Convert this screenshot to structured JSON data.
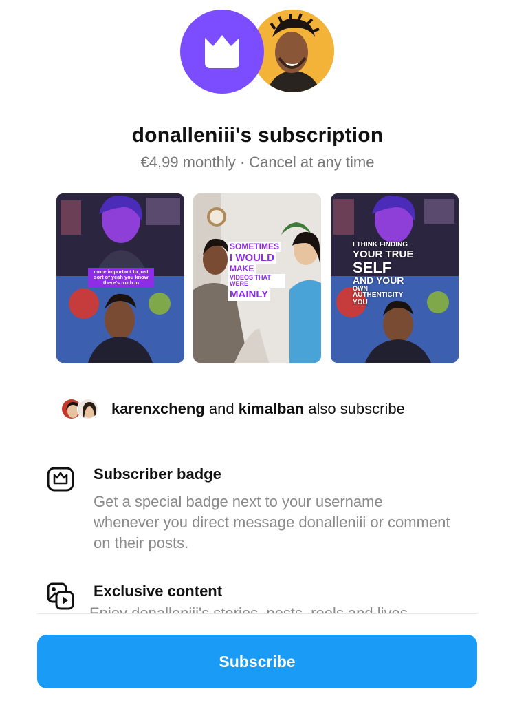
{
  "header": {
    "title": "donalleniii's subscription",
    "subtitle": "€4,99 monthly · Cancel at any time"
  },
  "previews": [
    {
      "caption": "more important to just sort of yeah you know there's truth in"
    },
    {
      "caption_lines": [
        "SOMETIMES",
        "I WOULD",
        "MAKE",
        "VIDEOS THAT WERE",
        "MAINLY"
      ]
    },
    {
      "caption_lines": [
        "I THINK FINDING",
        "YOUR TRUE",
        "SELF",
        "AND YOUR",
        "OWN",
        "AUTHENTICITY",
        "YOU"
      ]
    }
  ],
  "mutual": {
    "user1": "karenxcheng",
    "connector": "and",
    "user2": "kimalban",
    "suffix": "also subscribe"
  },
  "features": [
    {
      "icon": "crown-badge-icon",
      "title": "Subscriber badge",
      "description": "Get a special badge next to your username whenever you direct message donalleniii or comment on their posts."
    },
    {
      "icon": "exclusive-content-icon",
      "title": "Exclusive content",
      "description": "Enjoy donalleniii's stories, posts, reels and lives"
    }
  ],
  "subscribe_button": {
    "label": "Subscribe"
  },
  "colors": {
    "accent_purple": "#7c4dff",
    "button_blue": "#1a9bf5",
    "creator_bg": "#f3b338"
  }
}
